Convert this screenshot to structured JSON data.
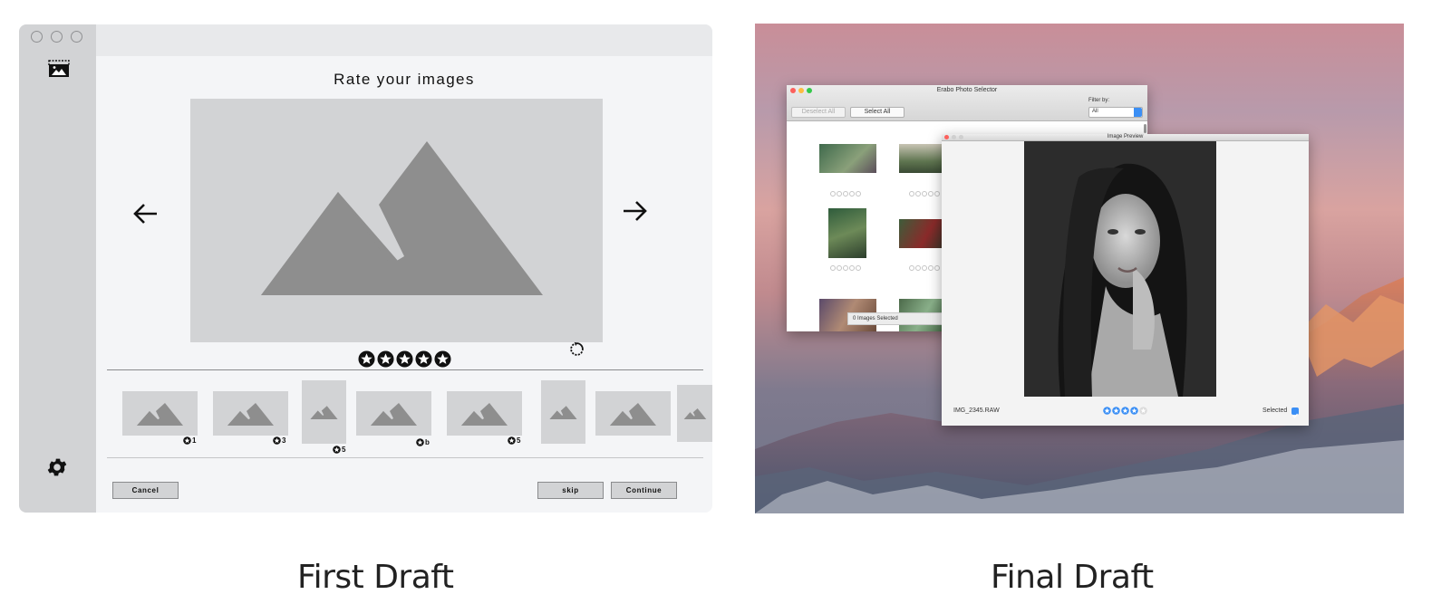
{
  "first_draft": {
    "title": "Rate your images",
    "star_count": 5,
    "thumbnails": [
      {
        "rating": "1"
      },
      {
        "rating": "3"
      },
      {
        "rating": "5"
      },
      {
        "rating": "b"
      },
      {
        "rating": "5"
      },
      {
        "rating": ""
      },
      {
        "rating": ""
      },
      {
        "rating": ""
      }
    ],
    "buttons": {
      "cancel": "Cancel",
      "skip": "skip",
      "continue": "Continue"
    },
    "caption": "First Draft"
  },
  "final_draft": {
    "selector_window": {
      "title": "Erabo Photo Selector",
      "deselect_all": "Deselect All",
      "select_all": "Select All",
      "filter_label": "Filter by:",
      "filter_value": "All",
      "status": "0 Images Selected"
    },
    "preview_window": {
      "title": "Image Preview",
      "filename": "IMG_2345.RAW",
      "rating": 4,
      "max_rating": 5,
      "selected_label": "Selected",
      "selected": true
    },
    "colors": {
      "accent": "#3b8ff5",
      "close": "#fc605c",
      "min": "#fdbc40",
      "max": "#34c84a"
    },
    "caption": "Final Draft"
  }
}
